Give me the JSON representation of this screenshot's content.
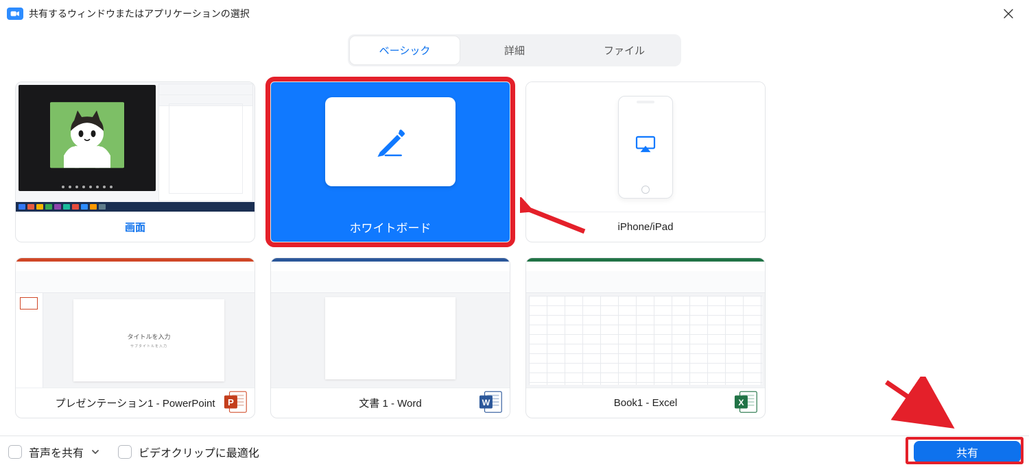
{
  "titlebar": {
    "title": "共有するウィンドウまたはアプリケーションの選択"
  },
  "tabs": {
    "basic": "ベーシック",
    "advanced": "詳細",
    "files": "ファイル"
  },
  "cards": {
    "screen": "画面",
    "whiteboard": "ホワイトボード",
    "iphone": "iPhone/iPad",
    "ppt": "プレゼンテーション1 - PowerPoint",
    "word": "文書 1 - Word",
    "excel": "Book1 - Excel"
  },
  "ppt_slide": {
    "title": "タイトルを入力",
    "subtitle": "サブタイトルを入力"
  },
  "footer": {
    "share_audio": "音声を共有",
    "optimize_video": "ビデオクリップに最適化",
    "share_button": "共有"
  },
  "icons": {
    "ppt_letter": "P",
    "word_letter": "W",
    "excel_letter": "X"
  }
}
